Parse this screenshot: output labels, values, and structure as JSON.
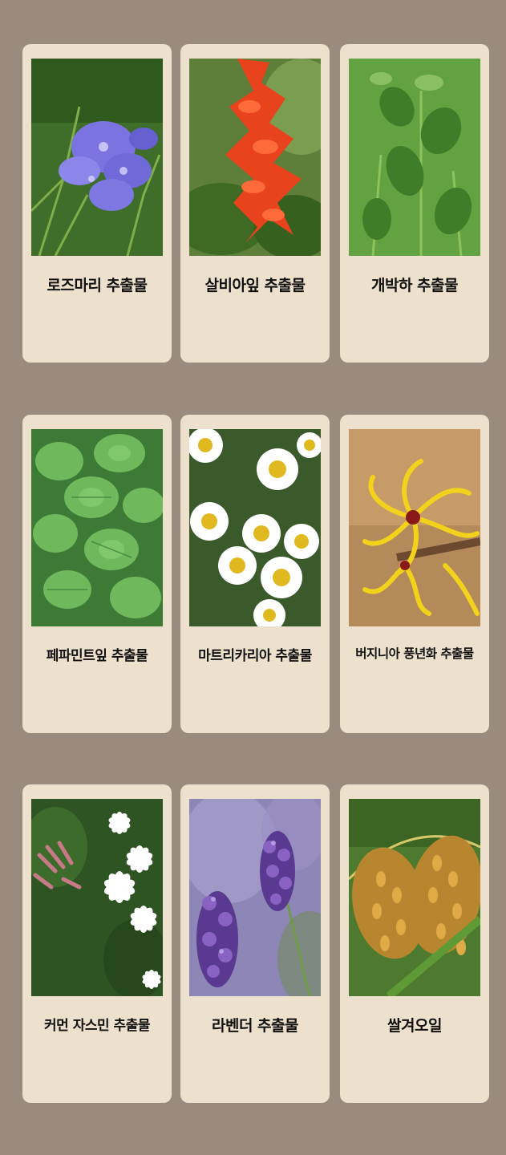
{
  "items": [
    {
      "label": "로즈마리 추출물",
      "icon": "rosemary-flower-photo"
    },
    {
      "label": "살비아잎 추출물",
      "icon": "salvia-flower-photo"
    },
    {
      "label": "개박하 추출물",
      "icon": "catnip-plant-photo"
    },
    {
      "label": "페파민트잎 추출물",
      "icon": "peppermint-leaf-photo"
    },
    {
      "label": "마트리카리아 추출물",
      "icon": "chamomile-flower-photo"
    },
    {
      "label": "버지니아 풍년화 추출물",
      "icon": "witch-hazel-flower-photo"
    },
    {
      "label": "커먼 자스민 추출물",
      "icon": "jasmine-flower-photo"
    },
    {
      "label": "라벤더 추출물",
      "icon": "lavender-flower-photo"
    },
    {
      "label": "쌀겨오일",
      "icon": "rice-grain-photo"
    }
  ],
  "colors": {
    "background": "#9a8b7e",
    "card": "#ede0cc",
    "text": "#111111"
  }
}
